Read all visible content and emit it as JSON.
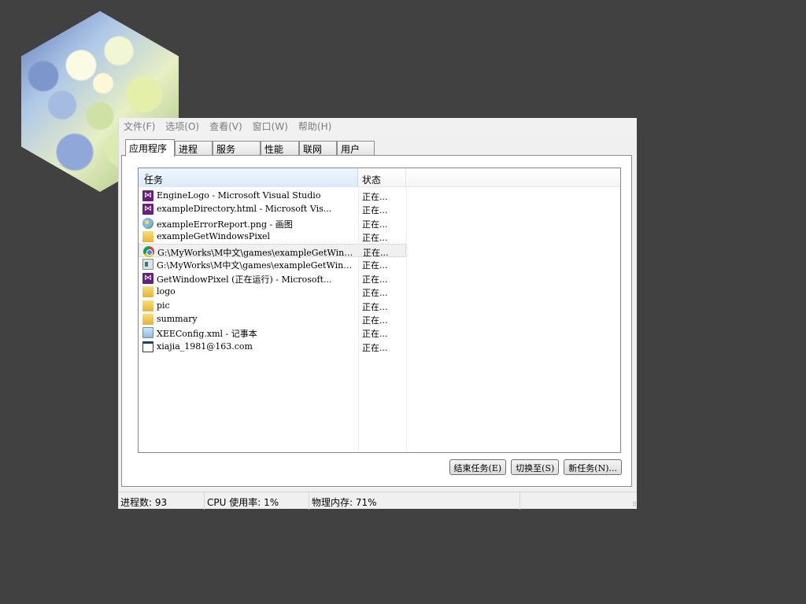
{
  "window": {
    "menu": [
      "文件(F)",
      "选项(O)",
      "查看(V)",
      "窗口(W)",
      "帮助(H)"
    ],
    "tabs": [
      "应用程序",
      "进程",
      "服务",
      "性能",
      "联网",
      "用户"
    ],
    "active_tab": "应用程序"
  },
  "list": {
    "columns": {
      "task": "任务",
      "status": "状态"
    },
    "rows": [
      {
        "task": "EngineLogo - Microsoft Visual Studio",
        "status": "正在...",
        "icon": "visual-studio-icon"
      },
      {
        "task": "exampleDirectory.html - Microsoft Vis...",
        "status": "正在...",
        "icon": "visual-studio-icon"
      },
      {
        "task": "exampleErrorReport.png - 画图",
        "status": "正在...",
        "icon": "paint-icon"
      },
      {
        "task": "exampleGetWindowsPixel",
        "status": "正在...",
        "icon": "folder-icon"
      },
      {
        "task": "G:\\MyWorks\\M中文\\games\\exampleGetWind...",
        "status": "正在...",
        "icon": "chrome-icon"
      },
      {
        "task": "G:\\MyWorks\\M中文\\games\\exampleGetWind...",
        "status": "正在...",
        "icon": "app-icon"
      },
      {
        "task": "GetWindowPixel (正在运行) - Microsoft...",
        "status": "正在...",
        "icon": "visual-studio-icon"
      },
      {
        "task": "logo",
        "status": "正在...",
        "icon": "folder-icon"
      },
      {
        "task": "pic",
        "status": "正在...",
        "icon": "folder-icon"
      },
      {
        "task": "summary",
        "status": "正在...",
        "icon": "folder-icon"
      },
      {
        "task": "XEEConfig.xml - 记事本",
        "status": "正在...",
        "icon": "notepad-icon"
      },
      {
        "task": "xiajia_1981@163.com",
        "status": "正在...",
        "icon": "window-icon"
      }
    ],
    "selected_row": 4
  },
  "buttons": {
    "end_task": "结束任务(E)",
    "switch_to": "切换至(S)",
    "new_task": "新任务(N)..."
  },
  "statusbar": {
    "processes": "进程数: 93",
    "cpu": "CPU 使用率: 1%",
    "memory": "物理内存: 71%"
  }
}
